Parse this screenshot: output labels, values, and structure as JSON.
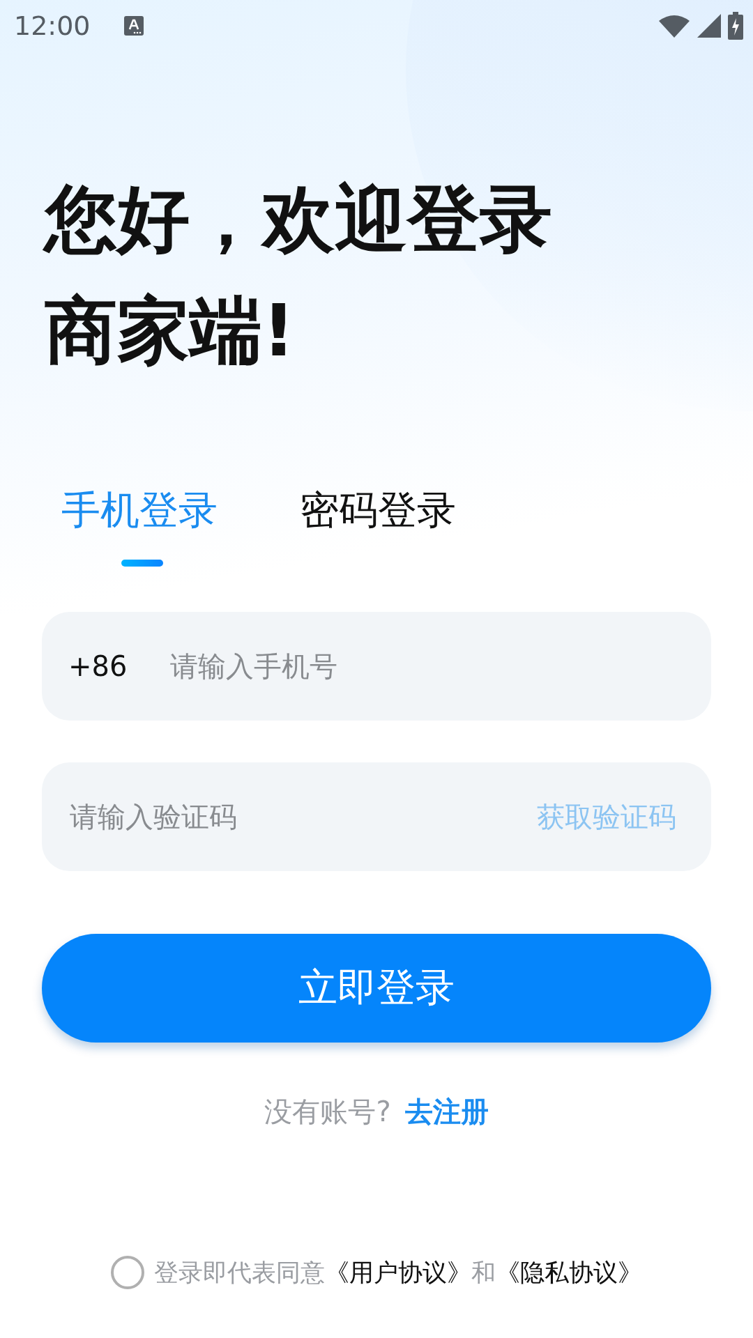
{
  "status_bar": {
    "time": "12:00"
  },
  "greeting": [
    "您好，欢迎登录",
    "商家端!"
  ],
  "tabs": [
    {
      "label": "手机登录",
      "selected": true
    },
    {
      "label": "密码登录",
      "selected": false
    }
  ],
  "phone_field": {
    "prefix": "+86",
    "placeholder": "请输入手机号"
  },
  "code_field": {
    "placeholder": "请输入验证码",
    "action": "获取验证码"
  },
  "login_button": "立即登录",
  "register": {
    "prompt": "没有账号?",
    "link": "去注册"
  },
  "agreement": {
    "checked": false,
    "parts": [
      {
        "kind": "text",
        "text": "登录即代表同意"
      },
      {
        "kind": "link",
        "text": "《用户协议》"
      },
      {
        "kind": "text",
        "text": "和"
      },
      {
        "kind": "link",
        "text": "《隐私协议》"
      }
    ]
  }
}
